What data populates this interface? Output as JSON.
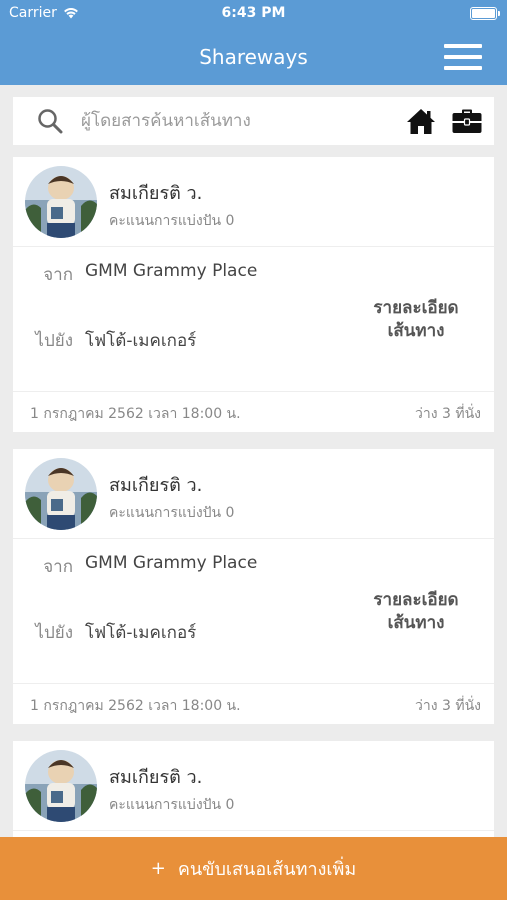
{
  "status_bar": {
    "carrier": "Carrier",
    "time": "6:43 PM"
  },
  "header": {
    "title": "Shareways"
  },
  "search": {
    "placeholder": "ผู้โดยสารค้นหาเส้นทาง"
  },
  "rides": [
    {
      "driver_name": "สมเกียรติ ว.",
      "score_text": "คะแนนการแบ่งปัน 0",
      "from_label": "จาก",
      "from": "GMM Grammy Place",
      "to_label": "ไปยัง",
      "to": "โฟโต้-เมคเกอร์",
      "details_label_1": "รายละเอียด",
      "details_label_2": "เส้นทาง",
      "departure": "1 กรกฎาคม 2562 เวลา 18:00 น.",
      "seats": "ว่าง 3 ที่นั่ง"
    },
    {
      "driver_name": "สมเกียรติ ว.",
      "score_text": "คะแนนการแบ่งปัน 0",
      "from_label": "จาก",
      "from": "GMM Grammy Place",
      "to_label": "ไปยัง",
      "to": "โฟโต้-เมคเกอร์",
      "details_label_1": "รายละเอียด",
      "details_label_2": "เส้นทาง",
      "departure": "1 กรกฎาคม 2562 เวลา 18:00 น.",
      "seats": "ว่าง 3 ที่นั่ง"
    },
    {
      "driver_name": "สมเกียรติ ว.",
      "score_text": "คะแนนการแบ่งปัน 0"
    }
  ],
  "cta": {
    "icon": "+",
    "label": "คนขับเสนอเส้นทางเพิ่ม"
  },
  "colors": {
    "primary": "#5b9bd5",
    "accent": "#e8903a",
    "background": "#ececec"
  }
}
